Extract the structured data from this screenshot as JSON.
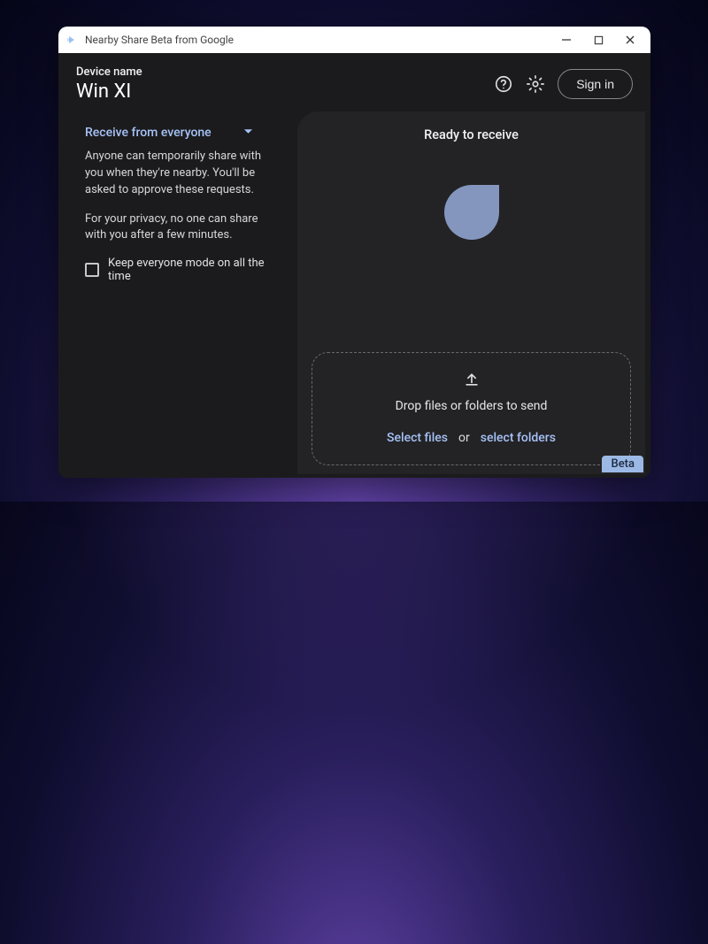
{
  "window": {
    "title": "Nearby Share Beta from Google"
  },
  "header": {
    "device_label": "Device name",
    "device_name": "Win XI",
    "signin_label": "Sign in"
  },
  "left_panel": {
    "receive_mode_label": "Receive from everyone",
    "desc1": "Anyone can temporarily share with you when they're nearby. You'll be asked to approve these requests.",
    "desc2": "For your privacy, no one can share with you after a few minutes.",
    "checkbox_label": "Keep everyone mode on all the time"
  },
  "right_panel": {
    "ready_label": "Ready to receive",
    "drop_label": "Drop files or folders to send",
    "select_files_label": "Select files",
    "or_label": "or",
    "select_folders_label": "select folders"
  },
  "footer": {
    "beta_label": "Beta"
  },
  "colors": {
    "accent_link": "#a7c2f8",
    "app_bg": "#1b1b1d",
    "panel_bg": "#232325",
    "avatar": "#8496bd"
  }
}
